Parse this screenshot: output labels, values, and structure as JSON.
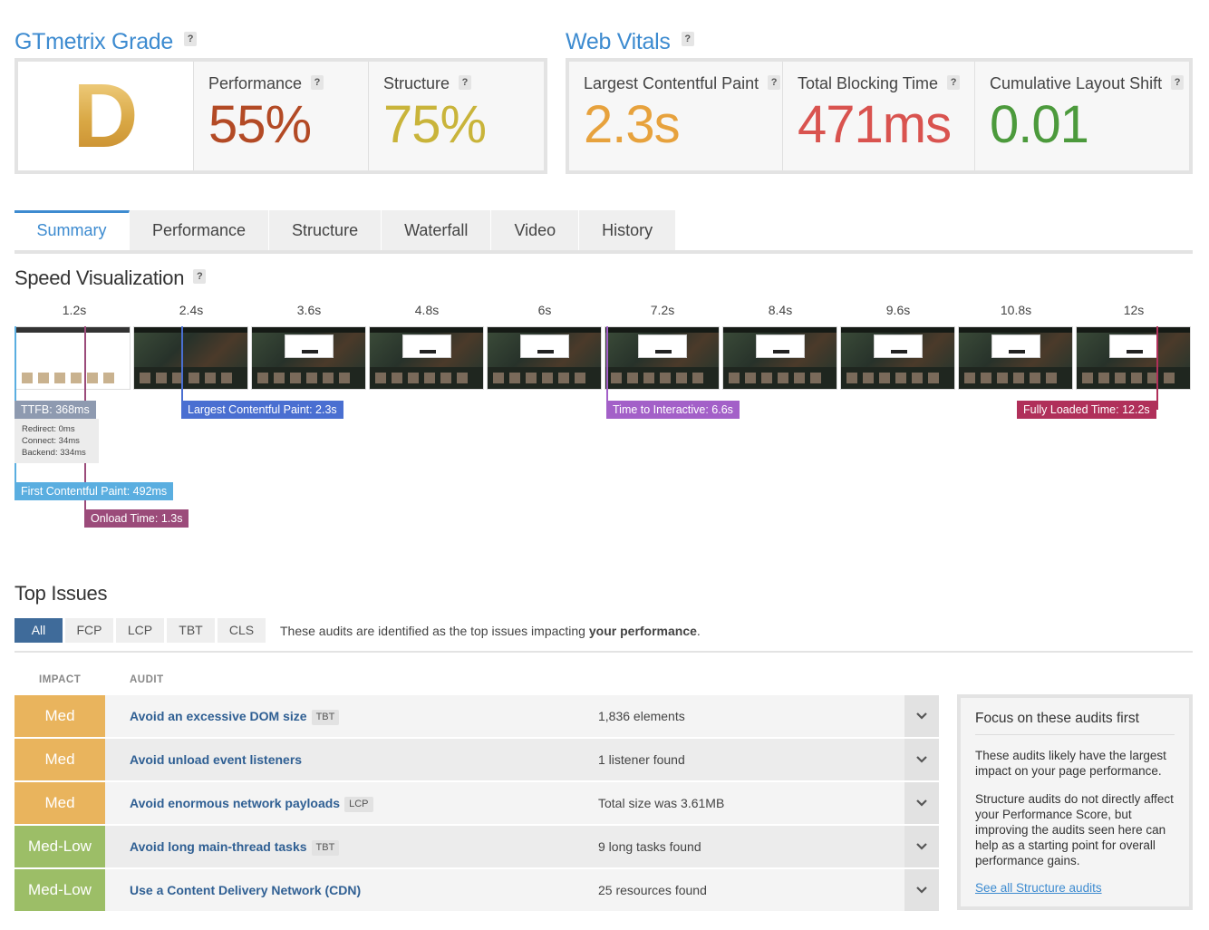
{
  "grade": {
    "title": "GTmetrix Grade",
    "letter": "D",
    "performance_label": "Performance",
    "performance_value": "55%",
    "structure_label": "Structure",
    "structure_value": "75%"
  },
  "vitals": {
    "title": "Web Vitals",
    "lcp_label": "Largest Contentful Paint",
    "lcp_value": "2.3s",
    "tbt_label": "Total Blocking Time",
    "tbt_value": "471ms",
    "cls_label": "Cumulative Layout Shift",
    "cls_value": "0.01"
  },
  "colors": {
    "accent": "#3d8bd0",
    "performance": "#b34a25",
    "structure": "#c9b43a",
    "lcp": "#e7a23d",
    "tbt": "#d9534f",
    "cls": "#4c9a3c",
    "impact_med": "#e9b45d",
    "impact_medlow": "#9cbe67"
  },
  "tabs": [
    "Summary",
    "Performance",
    "Structure",
    "Waterfall",
    "Video",
    "History"
  ],
  "speed": {
    "title": "Speed Visualization",
    "ticks": [
      "1.2s",
      "2.4s",
      "3.6s",
      "4.8s",
      "6s",
      "7.2s",
      "8.4s",
      "9.6s",
      "10.8s",
      "12s"
    ],
    "ttfb": "TTFB: 368ms",
    "redirect": "Redirect: 0ms",
    "connect": "Connect: 34ms",
    "backend": "Backend: 334ms",
    "lcp": "Largest Contentful Paint: 2.3s",
    "tti": "Time to Interactive: 6.6s",
    "fully_loaded": "Fully Loaded Time: 12.2s",
    "fcp": "First Contentful Paint: 492ms",
    "onload": "Onload Time: 1.3s"
  },
  "issues": {
    "title": "Top Issues",
    "filters": [
      "All",
      "FCP",
      "LCP",
      "TBT",
      "CLS"
    ],
    "description_pre": "These audits are identified as the top issues impacting ",
    "description_bold": "your performance",
    "description_post": ".",
    "col_impact": "IMPACT",
    "col_audit": "AUDIT",
    "rows": [
      {
        "impact": "Med",
        "audit": "Avoid an excessive DOM size",
        "tag": "TBT",
        "result": "1,836 elements"
      },
      {
        "impact": "Med",
        "audit": "Avoid unload event listeners",
        "tag": "",
        "result": "1 listener found"
      },
      {
        "impact": "Med",
        "audit": "Avoid enormous network payloads",
        "tag": "LCP",
        "result": "Total size was 3.61MB"
      },
      {
        "impact": "Med-Low",
        "audit": "Avoid long main-thread tasks",
        "tag": "TBT",
        "result": "9 long tasks found"
      },
      {
        "impact": "Med-Low",
        "audit": "Use a Content Delivery Network (CDN)",
        "tag": "",
        "result": "25 resources found"
      }
    ]
  },
  "focus": {
    "title": "Focus on these audits first",
    "p1": "These audits likely have the largest impact on your page performance.",
    "p2": "Structure audits do not directly affect your Performance Score, but improving the audits seen here can help as a starting point for overall performance gains.",
    "link": "See all Structure audits"
  }
}
